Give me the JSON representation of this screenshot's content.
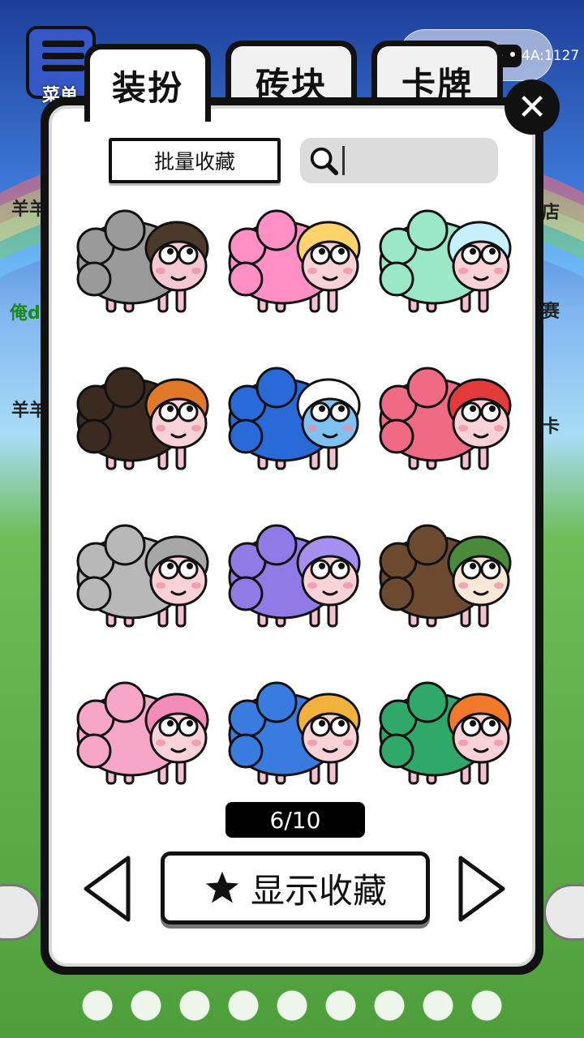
{
  "background": {
    "menu_label": "菜单",
    "left_labels": [
      "羊羊",
      "俺d",
      "羊羊"
    ],
    "right_labels": [
      "店",
      "赛",
      "卡"
    ]
  },
  "capsule": {
    "text": "4A:1127"
  },
  "tabs": [
    {
      "label": "装扮",
      "active": true
    },
    {
      "label": "砖块",
      "active": false
    },
    {
      "label": "卡牌",
      "active": false
    }
  ],
  "toolbar": {
    "batch_label": "批量收藏",
    "search_placeholder": ""
  },
  "skins": [
    {
      "icon": "sheep-girl-skin",
      "wool": "#9a9a9a",
      "body": "#f6c8d4",
      "hair": "#4b3a2a"
    },
    {
      "icon": "cupcake-sheep-skin",
      "wool": "#ff8fc4",
      "body": "#f9d2d8",
      "hair": "#ffd36b"
    },
    {
      "icon": "lucky-scratch-sheep-skin",
      "wool": "#9be8c8",
      "body": "#f9d2d8",
      "hair": "#c7f0ff"
    },
    {
      "icon": "cat-pilot-sheep-skin",
      "wool": "#3a2a1f",
      "body": "#f9d2d8",
      "hair": "#e07a2a"
    },
    {
      "icon": "iceberg-sheep-skin",
      "wool": "#2a6ad8",
      "body": "#7fc2f2",
      "hair": "#ffffff"
    },
    {
      "icon": "strawberry-pig-sheep-skin",
      "wool": "#f06a86",
      "body": "#f9d2d8",
      "hair": "#e23b3b"
    },
    {
      "icon": "autumn-cap-sheep-skin",
      "wool": "#b8b8b8",
      "body": "#f9d2d8",
      "hair": "#a7a7a7"
    },
    {
      "icon": "lavender-girl-sheep-skin",
      "wool": "#8f7ae6",
      "body": "#f9d2d8",
      "hair": "#a78ff0"
    },
    {
      "icon": "tiramisu-sheep-skin",
      "wool": "#6b4a2f",
      "body": "#f9e8d8",
      "hair": "#4a8a3a"
    },
    {
      "icon": "sakura-girl-sheep-skin",
      "wool": "#f7a6c8",
      "body": "#f9d2d8",
      "hair": "#f48bb8"
    },
    {
      "icon": "flower-bush-sheep-skin",
      "wool": "#3a7be0",
      "body": "#f9d2d8",
      "hair": "#f2b13a"
    },
    {
      "icon": "hula-girl-sheep-skin",
      "wool": "#2fa86a",
      "body": "#f9d2d8",
      "hair": "#f07a2a"
    }
  ],
  "pager": {
    "text": "6/10"
  },
  "footer": {
    "show_fav_label": "显示收藏"
  }
}
